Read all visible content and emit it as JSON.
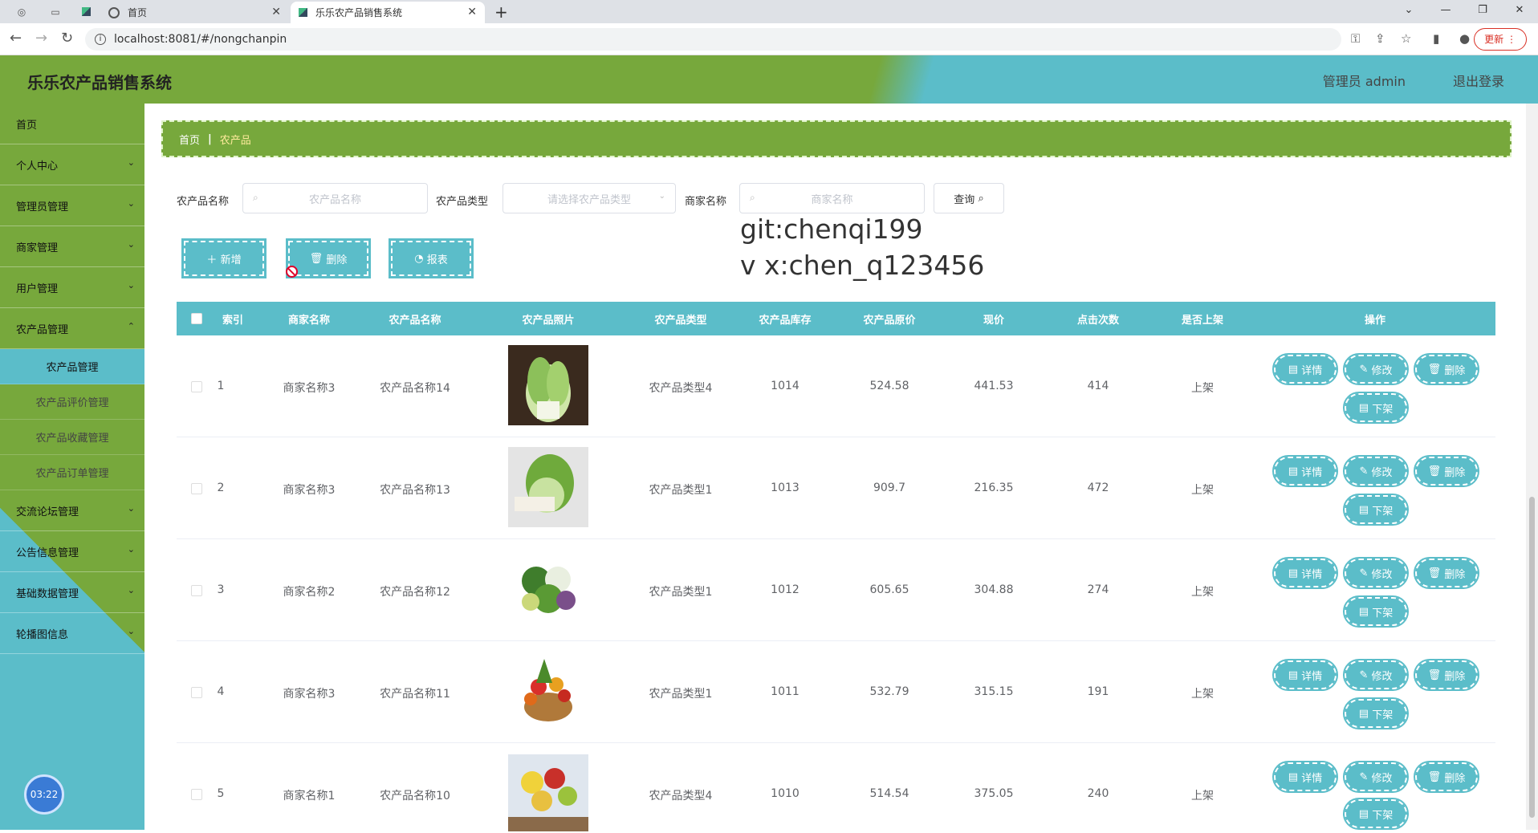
{
  "browser": {
    "tabs": [
      {
        "title": "首页"
      },
      {
        "title": "乐乐农产品销售系统"
      }
    ],
    "url": "localhost:8081/#/nongchanpin",
    "update_label": "更新"
  },
  "header": {
    "title": "乐乐农产品销售系统",
    "user": "管理员 admin",
    "logout": "退出登录"
  },
  "sidebar": {
    "items": [
      {
        "label": "首页"
      },
      {
        "label": "个人中心"
      },
      {
        "label": "管理员管理"
      },
      {
        "label": "商家管理"
      },
      {
        "label": "用户管理"
      },
      {
        "label": "农产品管理"
      }
    ],
    "subitems": [
      {
        "label": "农产品管理"
      },
      {
        "label": "农产品评价管理"
      },
      {
        "label": "农产品收藏管理"
      },
      {
        "label": "农产品订单管理"
      }
    ],
    "items2": [
      {
        "label": "交流论坛管理"
      },
      {
        "label": "公告信息管理"
      },
      {
        "label": "基础数据管理"
      },
      {
        "label": "轮播图信息"
      }
    ],
    "clock": "03:22"
  },
  "breadcrumb": {
    "home": "首页",
    "current": "农产品"
  },
  "filters": {
    "name_label": "农产品名称",
    "name_placeholder": "农产品名称",
    "type_label": "农产品类型",
    "type_placeholder": "请选择农产品类型",
    "merchant_label": "商家名称",
    "merchant_placeholder": "商家名称",
    "query": "查询"
  },
  "actions": {
    "add": "新增",
    "delete": "删除",
    "report": "报表"
  },
  "watermark": {
    "line1": "git:chenqi199",
    "line2": "v x:chen_q123456"
  },
  "table": {
    "headers": [
      "索引",
      "商家名称",
      "农产品名称",
      "农产品照片",
      "农产品类型",
      "农产品库存",
      "农产品原价",
      "现价",
      "点击次数",
      "是否上架",
      "操作"
    ],
    "rows": [
      {
        "index": "1",
        "merchant": "商家名称3",
        "name": "农产品名称14",
        "type": "农产品类型4",
        "stock": "1014",
        "orig": "524.58",
        "price": "441.53",
        "clicks": "414",
        "status": "上架"
      },
      {
        "index": "2",
        "merchant": "商家名称3",
        "name": "农产品名称13",
        "type": "农产品类型1",
        "stock": "1013",
        "orig": "909.7",
        "price": "216.35",
        "clicks": "472",
        "status": "上架"
      },
      {
        "index": "3",
        "merchant": "商家名称2",
        "name": "农产品名称12",
        "type": "农产品类型1",
        "stock": "1012",
        "orig": "605.65",
        "price": "304.88",
        "clicks": "274",
        "status": "上架"
      },
      {
        "index": "4",
        "merchant": "商家名称3",
        "name": "农产品名称11",
        "type": "农产品类型1",
        "stock": "1011",
        "orig": "532.79",
        "price": "315.15",
        "clicks": "191",
        "status": "上架"
      },
      {
        "index": "5",
        "merchant": "商家名称1",
        "name": "农产品名称10",
        "type": "农产品类型4",
        "stock": "1010",
        "orig": "514.54",
        "price": "375.05",
        "clicks": "240",
        "status": "上架"
      }
    ],
    "op_labels": {
      "detail": "详情",
      "edit": "修改",
      "delete": "删除",
      "offshelf": "下架"
    }
  }
}
